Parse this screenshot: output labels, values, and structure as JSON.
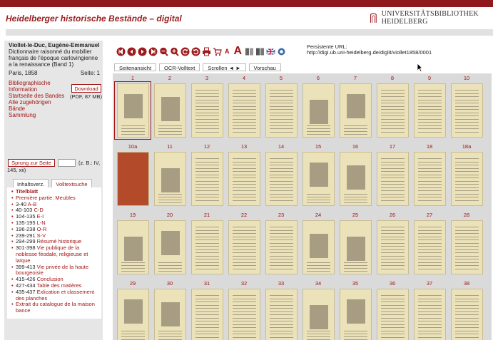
{
  "header": {
    "site_title": "Heidelberger historische Bestände – digital",
    "logo_text": "UNIVERSITÄTSBIBLIOTHEK HEIDELBERG",
    "colors": {
      "accent": "#9b1c1f",
      "bar": "#8e1a1d",
      "thumb_bg": "#ece2b9"
    }
  },
  "sidebar": {
    "author": "Viollet-le-Duc, Eugène-Emmanuel",
    "title": "Dictionnaire raisonné du mobilier français de l'époque carlovingienne a la renaissance (Band 1)",
    "place": "Paris, 1858",
    "page_label": "Seite: 1",
    "links": [
      "Bibliographische Information",
      "Startseite des Bandes",
      "Alle zugehörigen Bände",
      "Sammlung"
    ],
    "download_label": "Download",
    "download_size": "(PDF, 87 MB)",
    "jump_label": "Sprung zur Seite",
    "jump_hint": "(z. B.: IV,",
    "jump_hint2": "145, xii)",
    "tabs": [
      "Inhaltsverz.",
      "Volltextsuche"
    ],
    "toc": [
      {
        "range": "",
        "label": "Titelblatt"
      },
      {
        "range": "",
        "label": "Première partie: Meubles"
      },
      {
        "range": "3-40",
        "label": "A-B"
      },
      {
        "range": "40-103",
        "label": "C-D"
      },
      {
        "range": "104-135",
        "label": "E-I"
      },
      {
        "range": "135-195",
        "label": "L-N"
      },
      {
        "range": "196-238",
        "label": "O-R"
      },
      {
        "range": "239-291",
        "label": "S-V"
      },
      {
        "range": "294-299",
        "label": "Résumé historique"
      },
      {
        "range": "301-398",
        "label": "Vie publique de la noblesse féodale, religieuse et laïque"
      },
      {
        "range": "399-413",
        "label": "Vie privée de la haute bourgeoisie"
      },
      {
        "range": "415-426",
        "label": "Conclusion"
      },
      {
        "range": "427-434",
        "label": "Table des matières"
      },
      {
        "range": "435-437",
        "label": "Exlication et classement des planches"
      },
      {
        "range": "",
        "label": "Extrait du catalogue de la maison bance"
      }
    ]
  },
  "main": {
    "toolbar_icons": [
      "first-page-icon",
      "previous-page-icon",
      "next-page-icon",
      "last-page-icon",
      "zoom-out-icon",
      "zoom-in-icon",
      "rotate-left-icon",
      "rotate-right-icon",
      "print-icon",
      "shopping-cart-icon",
      "font-small-icon",
      "font-large-icon",
      "grid-view-icon",
      "double-page-icon",
      "language-flag-icon",
      "cc-icon"
    ],
    "font_small": "A",
    "font_large": "A",
    "purl_label": "Persistente URL:",
    "purl_value": "http://digi.ub.uni-heidelberg.de/diglit/viollet1858/0001",
    "view_tabs": [
      "Seitenansicht",
      "OCR-Volltext",
      "Scrollen ◄ ►",
      "Vorschau"
    ],
    "thumb_labels": [
      "1",
      "2",
      "3",
      "4",
      "5",
      "6",
      "7",
      "8",
      "9",
      "10",
      "10a",
      "11",
      "12",
      "13",
      "14",
      "15",
      "16",
      "17",
      "18",
      "18a",
      "19",
      "20",
      "21",
      "22",
      "23",
      "24",
      "25",
      "26",
      "27",
      "28",
      "29",
      "30",
      "31",
      "32",
      "33",
      "34",
      "35",
      "36",
      "37",
      "38"
    ]
  }
}
